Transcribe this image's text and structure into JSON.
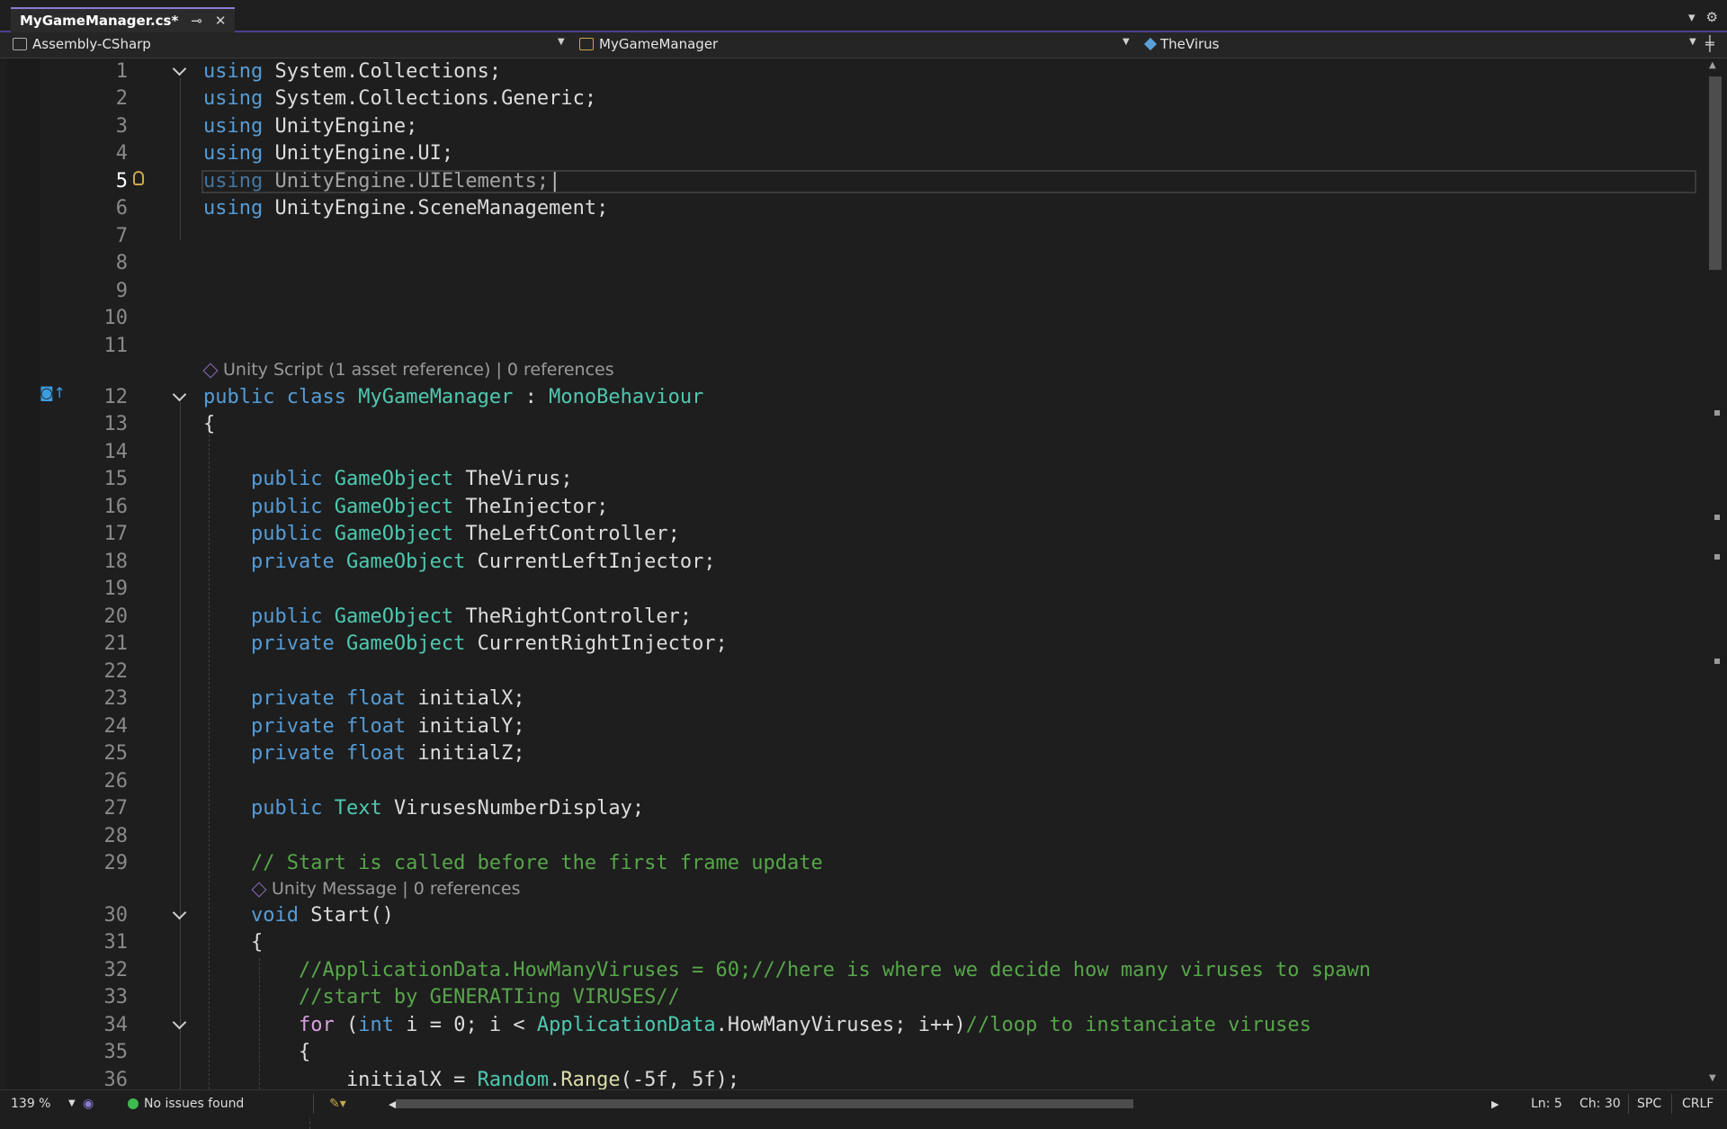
{
  "tab": {
    "title": "MyGameManager.cs*",
    "pin": "⊸",
    "close": "✕"
  },
  "window_controls": {
    "dropdown": "▾",
    "settings": "⚙"
  },
  "navbar": {
    "project": "Assembly-CSharp",
    "class": "MyGameManager",
    "member": "TheVirus"
  },
  "codelens": {
    "class": "Unity Script (1 asset reference) | 0 references",
    "start": "Unity Message | 0 references"
  },
  "lines": [
    {
      "n": "1",
      "text": "using System.Collections;"
    },
    {
      "n": "2",
      "text": "using System.Collections.Generic;"
    },
    {
      "n": "3",
      "text": "using UnityEngine;"
    },
    {
      "n": "4",
      "text": "using UnityEngine.UI;"
    },
    {
      "n": "5",
      "text": "using UnityEngine.UIElements;"
    },
    {
      "n": "6",
      "text": "using UnityEngine.SceneManagement;"
    },
    {
      "n": "7",
      "text": ""
    },
    {
      "n": "8",
      "text": ""
    },
    {
      "n": "9",
      "text": ""
    },
    {
      "n": "10",
      "text": ""
    },
    {
      "n": "11",
      "text": ""
    },
    {
      "n": "12",
      "text": "public class MyGameManager : MonoBehaviour"
    },
    {
      "n": "13",
      "text": "{"
    },
    {
      "n": "14",
      "text": ""
    },
    {
      "n": "15",
      "text": "public GameObject TheVirus;"
    },
    {
      "n": "16",
      "text": "public GameObject TheInjector;"
    },
    {
      "n": "17",
      "text": "public GameObject TheLeftController;"
    },
    {
      "n": "18",
      "text": "private GameObject CurrentLeftInjector;"
    },
    {
      "n": "19",
      "text": ""
    },
    {
      "n": "20",
      "text": "public GameObject TheRightController;"
    },
    {
      "n": "21",
      "text": "private GameObject CurrentRightInjector;"
    },
    {
      "n": "22",
      "text": ""
    },
    {
      "n": "23",
      "text": "private float initialX;"
    },
    {
      "n": "24",
      "text": "private float initialY;"
    },
    {
      "n": "25",
      "text": "private float initialZ;"
    },
    {
      "n": "26",
      "text": ""
    },
    {
      "n": "27",
      "text": "public Text VirusesNumberDisplay;"
    },
    {
      "n": "28",
      "text": ""
    },
    {
      "n": "29",
      "text": "// Start is called before the first frame update"
    },
    {
      "n": "30",
      "text": "void Start()"
    },
    {
      "n": "31",
      "text": "{"
    },
    {
      "n": "32",
      "text": "//ApplicationData.HowManyViruses = 60;///here is where we decide how many viruses to spawn"
    },
    {
      "n": "33",
      "text": "//start by GENERATIing VIRUSES//"
    },
    {
      "n": "34",
      "text": "for (int i = 0; i < ApplicationData.HowManyViruses; i++)//loop to instanciate viruses"
    },
    {
      "n": "35",
      "text": "{"
    },
    {
      "n": "36",
      "text": "initialX = Random.Range(-5f, 5f);"
    }
  ],
  "status": {
    "zoom": "139 %",
    "issues": "No issues found",
    "ln": "Ln: 5",
    "ch": "Ch: 30",
    "spc": "SPC",
    "crlf": "CRLF"
  },
  "colors": {
    "keyword": "#569cd6",
    "type": "#4ec9b0",
    "comment": "#57a64a",
    "accent": "#8b7bd1"
  }
}
